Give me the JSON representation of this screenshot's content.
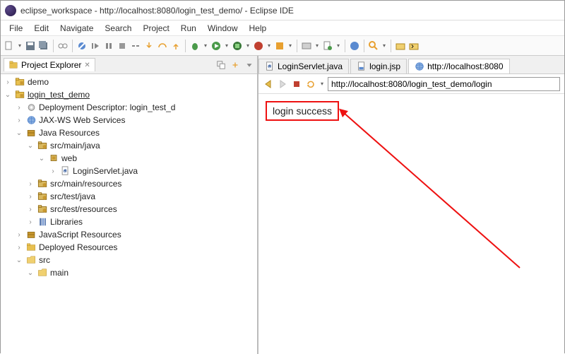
{
  "window": {
    "title": "eclipse_workspace - http://localhost:8080/login_test_demo/ - Eclipse IDE"
  },
  "menu": {
    "file": "File",
    "edit": "Edit",
    "navigate": "Navigate",
    "search": "Search",
    "project": "Project",
    "run": "Run",
    "window": "Window",
    "help": "Help"
  },
  "sidebar": {
    "tab": "Project Explorer",
    "items": [
      {
        "d": 0,
        "t": "c",
        "ic": "proj",
        "label": "demo"
      },
      {
        "d": 0,
        "t": "e",
        "ic": "proj",
        "label": "login_test_demo",
        "sel": true
      },
      {
        "d": 1,
        "t": "c",
        "ic": "gear",
        "label": "Deployment Descriptor: login_test_d"
      },
      {
        "d": 1,
        "t": "c",
        "ic": "globe",
        "label": "JAX-WS Web Services"
      },
      {
        "d": 1,
        "t": "e",
        "ic": "pkg",
        "label": "Java Resources"
      },
      {
        "d": 2,
        "t": "e",
        "ic": "srcf",
        "label": "src/main/java"
      },
      {
        "d": 3,
        "t": "e",
        "ic": "pkg2",
        "label": "web"
      },
      {
        "d": 4,
        "t": "c",
        "ic": "java",
        "label": "LoginServlet.java"
      },
      {
        "d": 2,
        "t": "c",
        "ic": "srcf",
        "label": "src/main/resources"
      },
      {
        "d": 2,
        "t": "c",
        "ic": "srcf",
        "label": "src/test/java"
      },
      {
        "d": 2,
        "t": "c",
        "ic": "srcf",
        "label": "src/test/resources"
      },
      {
        "d": 2,
        "t": "c",
        "ic": "lib",
        "label": "Libraries"
      },
      {
        "d": 1,
        "t": "c",
        "ic": "pkg",
        "label": "JavaScript Resources"
      },
      {
        "d": 1,
        "t": "c",
        "ic": "folder",
        "label": "Deployed Resources"
      },
      {
        "d": 1,
        "t": "e",
        "ic": "folder-open",
        "label": "src"
      },
      {
        "d": 2,
        "t": "e",
        "ic": "folder-open",
        "label": "main"
      }
    ]
  },
  "editor": {
    "tabs": [
      {
        "icon": "java",
        "label": "LoginServlet.java",
        "active": false
      },
      {
        "icon": "jsp",
        "label": "login.jsp",
        "active": false
      },
      {
        "icon": "globe",
        "label": "http://localhost:8080",
        "active": true
      }
    ],
    "nav": {
      "url": "http://localhost:8080/login_test_demo/login"
    },
    "content": {
      "result": "login success"
    }
  }
}
